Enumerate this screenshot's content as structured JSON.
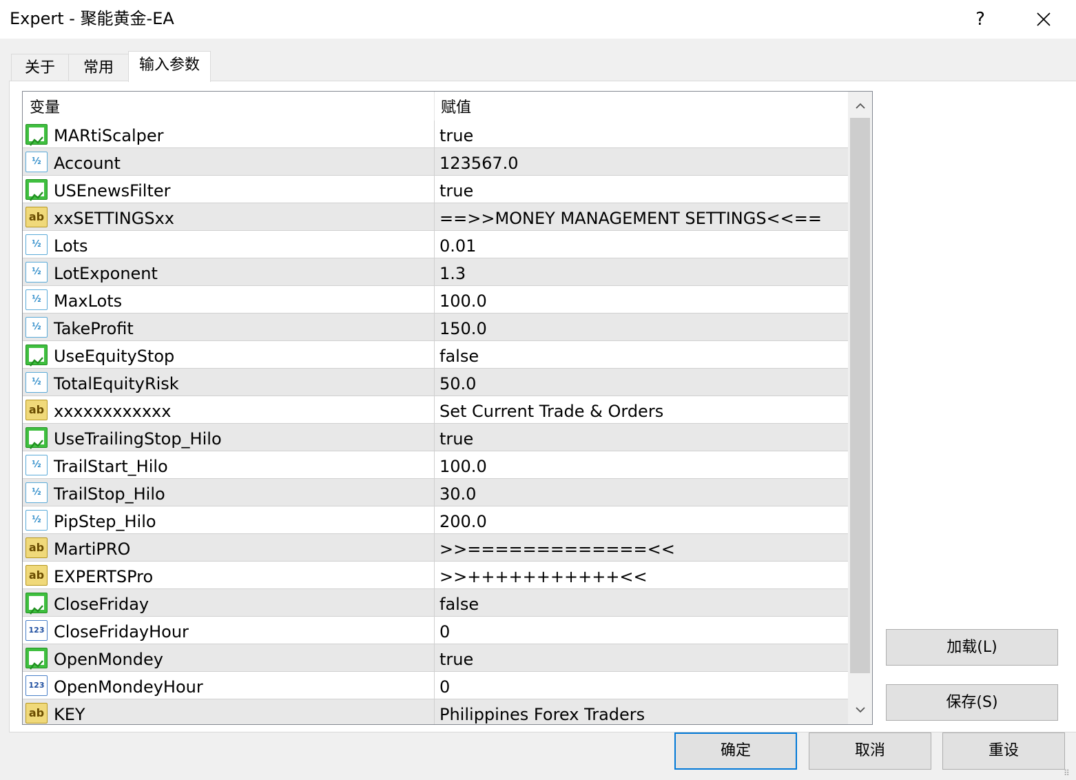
{
  "window": {
    "title": "Expert - 聚能黄金-EA",
    "help_label": "?"
  },
  "tabs": [
    {
      "label": "关于"
    },
    {
      "label": "常用"
    },
    {
      "label": "输入参数"
    }
  ],
  "grid": {
    "headers": {
      "variable": "变量",
      "value": "赋值"
    },
    "rows": [
      {
        "icon": "bool-icon",
        "name": "MARtiScalper",
        "value": "true"
      },
      {
        "icon": "double-icon",
        "name": "Account",
        "value": "123567.0"
      },
      {
        "icon": "bool-icon",
        "name": "USEnewsFilter",
        "value": "true"
      },
      {
        "icon": "string-icon",
        "name": "xxSETTINGSxx",
        "value": "==>>MONEY MANAGEMENT SETTINGS<<=="
      },
      {
        "icon": "double-icon",
        "name": "Lots",
        "value": "0.01"
      },
      {
        "icon": "double-icon",
        "name": "LotExponent",
        "value": "1.3"
      },
      {
        "icon": "double-icon",
        "name": "MaxLots",
        "value": "100.0"
      },
      {
        "icon": "double-icon",
        "name": "TakeProfit",
        "value": "150.0"
      },
      {
        "icon": "bool-icon",
        "name": "UseEquityStop",
        "value": "false"
      },
      {
        "icon": "double-icon",
        "name": "TotalEquityRisk",
        "value": "50.0"
      },
      {
        "icon": "string-icon",
        "name": "xxxxxxxxxxxx",
        "value": "Set Current Trade & Orders"
      },
      {
        "icon": "bool-icon",
        "name": "UseTrailingStop_Hilo",
        "value": "true"
      },
      {
        "icon": "double-icon",
        "name": "TrailStart_Hilo",
        "value": "100.0"
      },
      {
        "icon": "double-icon",
        "name": "TrailStop_Hilo",
        "value": "30.0"
      },
      {
        "icon": "double-icon",
        "name": "PipStep_Hilo",
        "value": "200.0"
      },
      {
        "icon": "string-icon",
        "name": "MartiPRO",
        "value": ">>=============<<"
      },
      {
        "icon": "string-icon",
        "name": "EXPERTSPro",
        "value": ">>+++++++++++<<"
      },
      {
        "icon": "bool-icon",
        "name": "CloseFriday",
        "value": "false"
      },
      {
        "icon": "int-icon",
        "name": "CloseFridayHour",
        "value": "0"
      },
      {
        "icon": "bool-icon",
        "name": "OpenMondey",
        "value": "true"
      },
      {
        "icon": "int-icon",
        "name": "OpenMondeyHour",
        "value": "0"
      },
      {
        "icon": "string-icon",
        "name": "KEY",
        "value": "Philippines Forex Traders"
      }
    ]
  },
  "icon_labels": {
    "double-icon": "½",
    "string-icon": "ab",
    "int-icon": "123"
  },
  "side_buttons": {
    "load": "加载(L)",
    "save": "保存(S)"
  },
  "footer_buttons": {
    "ok": "确定",
    "cancel": "取消",
    "reset": "重设"
  },
  "colors": {
    "accent": "#0078d7",
    "bool_icon": "#3fbf3f",
    "string_icon": "#f0d97a",
    "double_icon": "#5aaad8",
    "int_icon": "#4a80c8"
  }
}
